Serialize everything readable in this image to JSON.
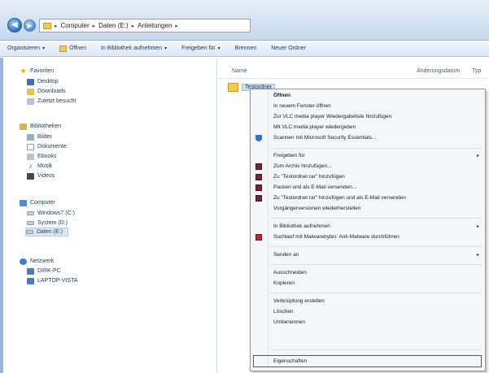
{
  "address": {
    "crumbs": [
      "Computer",
      "Daten (E:)",
      "Anleitungen"
    ]
  },
  "toolbar": {
    "organize": "Organisieren",
    "open": "Öffnen",
    "library": "In Bibliothek aufnehmen",
    "share": "Freigeben für",
    "burn": "Brennen",
    "new_folder": "Neuer Ordner"
  },
  "nav": {
    "favorites": "Favoriten",
    "desktop": "Desktop",
    "downloads": "Downloads",
    "recent": "Zuletzt besucht",
    "libraries": "Bibliotheken",
    "pictures": "Bilder",
    "documents": "Dokumente",
    "ebooks": "Ebooks",
    "music": "Musik",
    "videos": "Videos",
    "computer": "Computer",
    "drive_c": "Windows7 (C:)",
    "drive_d": "System (D:)",
    "drive_e": "Daten (E:)",
    "network": "Netzwerk",
    "pc1": "DIRK-PC",
    "pc2": "LAPTOP-VISTA"
  },
  "columns": {
    "name": "Name",
    "date": "Änderungsdatum",
    "type": "Typ"
  },
  "file": {
    "name": "Testordner"
  },
  "menu": {
    "open": "Öffnen",
    "open_new": "In neuem Fenster öffnen",
    "vlc_add": "Zur VLC media player Wiedergabeliste hinzufügen",
    "vlc_play": "Mit VLC media player wiedergeben",
    "mse": "Scannen mit Microsoft Security Essentials...",
    "share": "Freigeben für",
    "archive": "Zum Archiv hinzufügen...",
    "add_rar": "Zu \"Testordner.rar\" hinzufügen",
    "pack_mail": "Packen und als E-Mail versenden...",
    "rar_mail": "Zu \"Testordner.rar\" hinzufügen und als E-Mail versenden",
    "prev_versions": "Vorgängerversionen wiederherstellen",
    "library": "In Bibliothek aufnehmen",
    "malwarebytes": "Suchlauf mit Malwarebytes' Anti-Malware durchführen",
    "send_to": "Senden an",
    "cut": "Ausschneiden",
    "copy": "Kopieren",
    "shortcut": "Verknüpfung erstellen",
    "delete": "Löschen",
    "rename": "Umbenennen",
    "properties": "Eigenschaften",
    "submenu_arrow": "▸"
  }
}
